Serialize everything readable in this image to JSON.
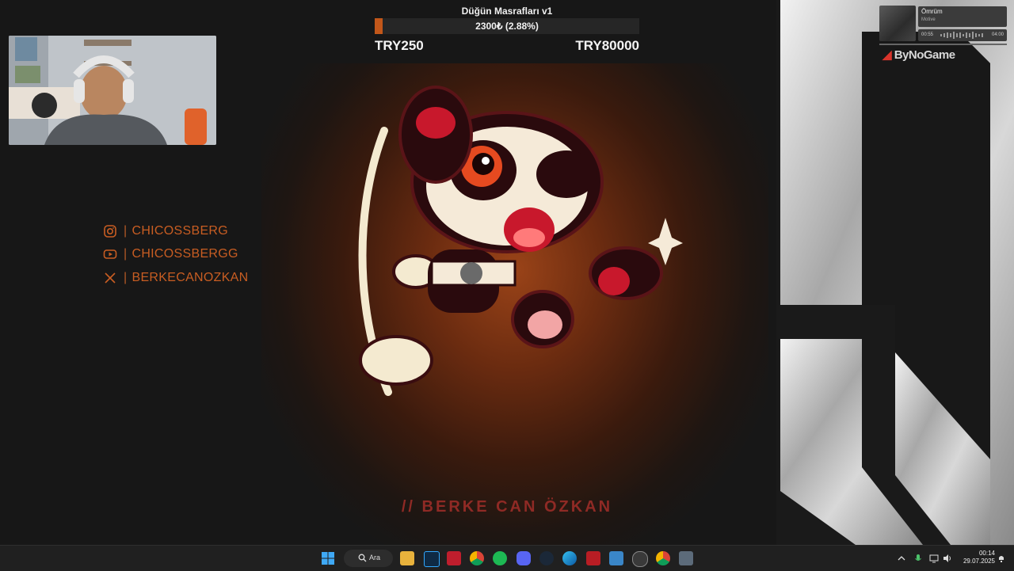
{
  "goal": {
    "title": "Düğün Masrafları v1",
    "amount": "2300₺ (2.88%)",
    "progress_percent": 2.88,
    "min_label": "TRY250",
    "max_label": "TRY80000"
  },
  "socials": [
    {
      "icon": "instagram-icon",
      "separator": "|",
      "handle": "CHICOSSBERG"
    },
    {
      "icon": "youtube-icon",
      "separator": "|",
      "handle": "CHICOSSBERGG"
    },
    {
      "icon": "x-icon",
      "separator": "|",
      "handle": "BERKECANOZKAN"
    }
  ],
  "tagline": "// BERKE CAN ÖZKAN",
  "now_playing": {
    "title": "Ömrüm",
    "artist": "Motive",
    "elapsed": "00:55",
    "duration": "04:00"
  },
  "brand": {
    "name": "ByNoGame"
  },
  "taskbar": {
    "search_label": "Ara",
    "time": "00:14",
    "date": "29.07.2025",
    "apps": [
      "windows-start-icon",
      "file-explorer-icon",
      "photoshop-icon",
      "filezilla-icon",
      "chrome-icon",
      "spotify-icon",
      "discord-icon",
      "steam-icon",
      "edge-icon",
      "winamp-icon",
      "app-icon",
      "obs-icon",
      "chrome-alt-icon",
      "calculator-icon"
    ]
  },
  "colors": {
    "accent": "#c2571a",
    "social_text": "#c85d22",
    "tagline": "#8f2a25",
    "background": "#171717"
  }
}
